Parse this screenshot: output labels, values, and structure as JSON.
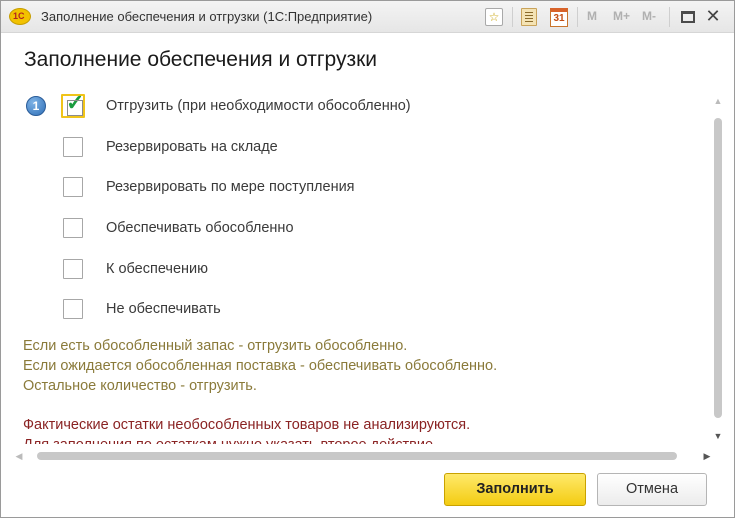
{
  "window": {
    "title": "Заполнение обеспечения и отгрузки  (1С:Предприятие)",
    "logo_text": "1С",
    "toolbar": {
      "calendar_day": "31",
      "m_label": "M",
      "m_plus_label": "M+",
      "m_minus_label": "M-",
      "close_glyph": "✕"
    }
  },
  "dialog": {
    "title": "Заполнение обеспечения и отгрузки",
    "info_badge": "1",
    "options": [
      {
        "label": "Отгрузить (при необходимости обособленно)",
        "checked": true
      },
      {
        "label": "Резервировать на складе",
        "checked": false
      },
      {
        "label": "Резервировать по мере поступления",
        "checked": false
      },
      {
        "label": "Обеспечивать обособленно",
        "checked": false
      },
      {
        "label": "К обеспечению",
        "checked": false
      },
      {
        "label": "Не обеспечивать",
        "checked": false
      }
    ],
    "description_lines": [
      "Если есть обособленный запас - отгрузить обособленно.",
      "Если ожидается обособленная поставка - обеспечивать обособленно.",
      "Остальное количество - отгрузить."
    ],
    "warning_lines": [
      "Фактические остатки необособленных товаров не анализируются.",
      "Для заполнения по остаткам нужно указать второе действие."
    ],
    "colors": {
      "description": "#8a7a3a",
      "warning": "#8a2323",
      "primary_button": "#f3cc12",
      "check": "#1a9c3e"
    }
  },
  "buttons": {
    "fill": "Заполнить",
    "cancel": "Отмена"
  }
}
